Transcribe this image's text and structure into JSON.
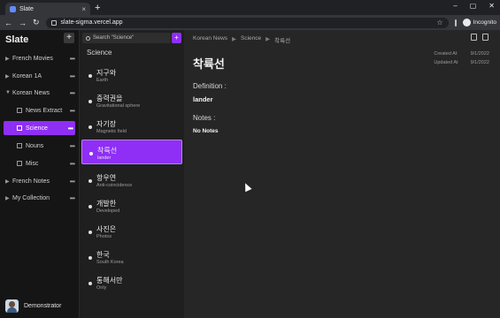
{
  "browser": {
    "tab_title": "Slate",
    "url": "slate-sigma.vercel.app",
    "profile_label": "Incognito"
  },
  "sidebar": {
    "brand": "Slate",
    "add_label": "+",
    "items": [
      {
        "label": "French Movies"
      },
      {
        "label": "Korean 1A"
      },
      {
        "label": "Korean News"
      },
      {
        "label": "News Extract"
      },
      {
        "label": "Science"
      },
      {
        "label": "Nouns"
      },
      {
        "label": "Misc"
      },
      {
        "label": "French Notes"
      },
      {
        "label": "My Collection"
      }
    ],
    "user": "Demonstrator"
  },
  "list": {
    "search_placeholder": "Search \"Science\"",
    "title": "Science",
    "cards": [
      {
        "word": "지구와",
        "meaning": "Earth"
      },
      {
        "word": "중력권을",
        "meaning": "Gravitational sphere"
      },
      {
        "word": "자기장",
        "meaning": "Magnetic field"
      },
      {
        "word": "착륙선",
        "meaning": "lander"
      },
      {
        "word": "항우연",
        "meaning": "Anti-coincidence"
      },
      {
        "word": "개발한",
        "meaning": "Developed"
      },
      {
        "word": "사진은",
        "meaning": "Photos"
      },
      {
        "word": "한국",
        "meaning": "South Korea"
      },
      {
        "word": "통해서만",
        "meaning": "Only"
      }
    ]
  },
  "detail": {
    "breadcrumb": [
      "Korean News",
      "Science",
      "착륙선"
    ],
    "title": "착륙선",
    "created_label": "Created At",
    "created_value": "9/1/2022",
    "updated_label": "Updated At",
    "updated_value": "9/1/2022",
    "definition_label": "Definition :",
    "definition_value": "lander",
    "notes_label": "Notes :",
    "notes_value": "No Notes"
  },
  "colors": {
    "accent": "#8f2ff5"
  }
}
